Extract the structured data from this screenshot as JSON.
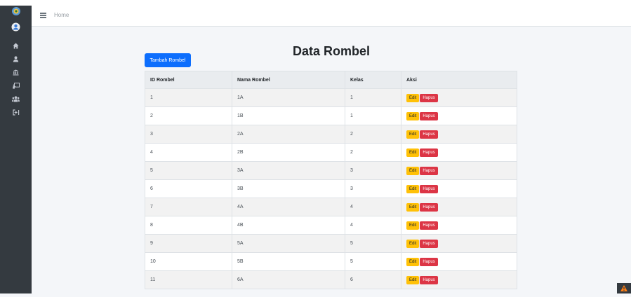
{
  "sidebar": {
    "items": [
      {
        "icon": "logo-icon"
      },
      {
        "icon": "user-avatar-icon"
      },
      {
        "icon": "home-icon"
      },
      {
        "icon": "user-icon"
      },
      {
        "icon": "building-icon"
      },
      {
        "icon": "chalkboard-icon"
      },
      {
        "icon": "users-icon"
      },
      {
        "icon": "logout-icon"
      }
    ]
  },
  "topbar": {
    "breadcrumb": "Home"
  },
  "main": {
    "title": "Data Rombel",
    "add_button": "Tambah Rombel",
    "table": {
      "headers": [
        "ID Rombel",
        "Nama Rombel",
        "Kelas",
        "Aksi"
      ],
      "edit_label": "Edit",
      "delete_label": "Hapus",
      "rows": [
        [
          "1",
          "1A",
          "1"
        ],
        [
          "2",
          "1B",
          "1"
        ],
        [
          "3",
          "2A",
          "2"
        ],
        [
          "4",
          "2B",
          "2"
        ],
        [
          "5",
          "3A",
          "3"
        ],
        [
          "6",
          "3B",
          "3"
        ],
        [
          "7",
          "4A",
          "4"
        ],
        [
          "8",
          "4B",
          "4"
        ],
        [
          "9",
          "5A",
          "5"
        ],
        [
          "10",
          "5B",
          "5"
        ],
        [
          "11",
          "6A",
          "6"
        ]
      ]
    }
  },
  "colors": {
    "sidebar": "#343a40",
    "primary": "#0d6efd",
    "warning": "#ffc107",
    "danger": "#dc3545"
  }
}
